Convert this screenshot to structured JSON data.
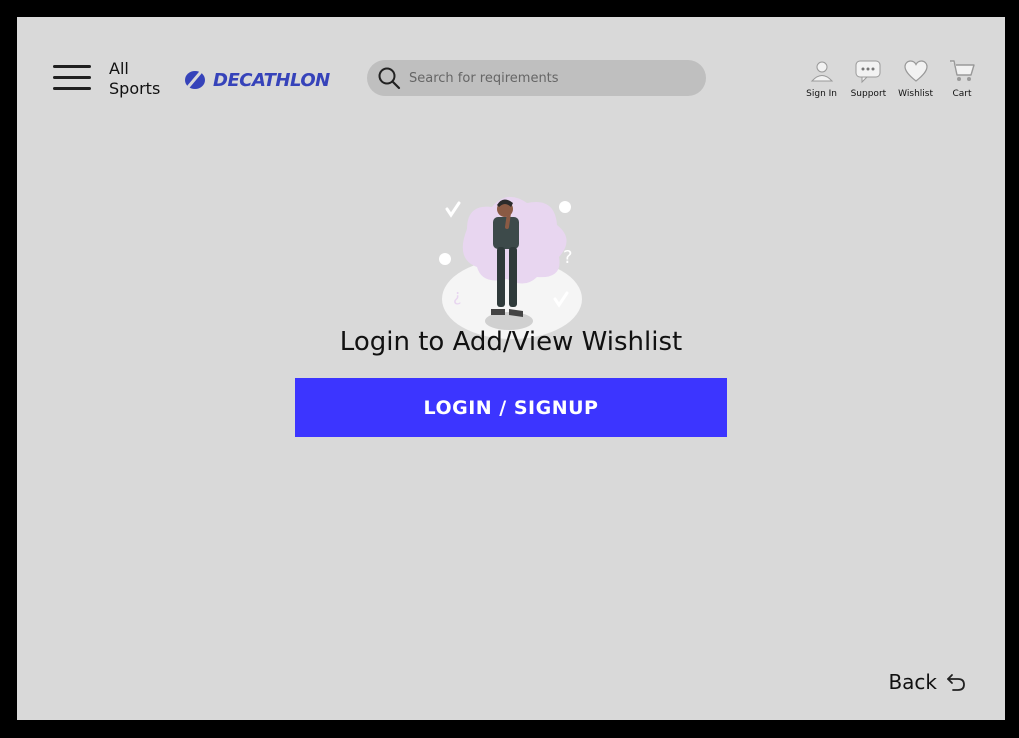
{
  "header": {
    "all_sports_label_line1": "All",
    "all_sports_label_line2": "Sports",
    "logo_text": "DECATHLON",
    "search_placeholder": "Search for reqirements",
    "actions": [
      {
        "label": "Sign In",
        "icon": "user-icon"
      },
      {
        "label": "Support",
        "icon": "chat-icon"
      },
      {
        "label": "Wishlist",
        "icon": "heart-icon"
      },
      {
        "label": "Cart",
        "icon": "cart-icon"
      }
    ]
  },
  "main": {
    "heading": "Login to Add/View Wishlist",
    "login_button_label": "LOGIN / SIGNUP"
  },
  "footer": {
    "back_label": "Back"
  },
  "colors": {
    "background": "#d9d9d9",
    "brand_blue": "#3643ba",
    "button_blue": "#3c35ff"
  }
}
